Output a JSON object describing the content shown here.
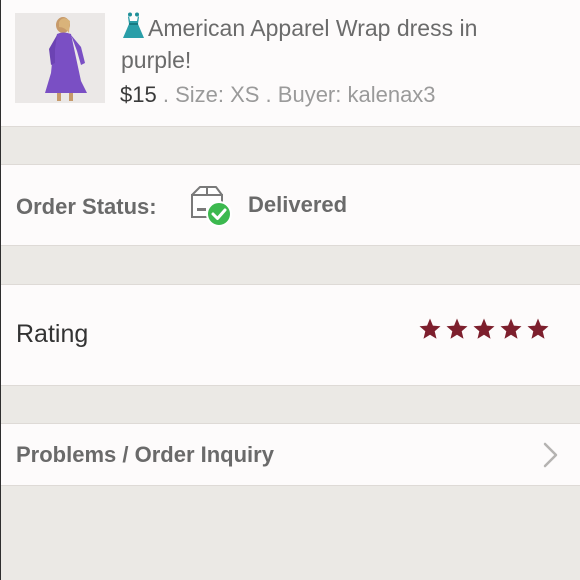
{
  "item": {
    "title": "American Apparel Wrap dress in purple!",
    "price": "$15",
    "size": "Size: XS",
    "buyer": "Buyer: kalenax3",
    "separator": " . "
  },
  "order_status": {
    "label": "Order Status:",
    "value": "Delivered",
    "icon": "package-delivered-icon",
    "badge_color": "#3cb94f"
  },
  "rating": {
    "label": "Rating",
    "stars": 5,
    "max_stars": 5,
    "star_color": "#7d1f2d"
  },
  "problems": {
    "label": "Problems / Order Inquiry"
  }
}
